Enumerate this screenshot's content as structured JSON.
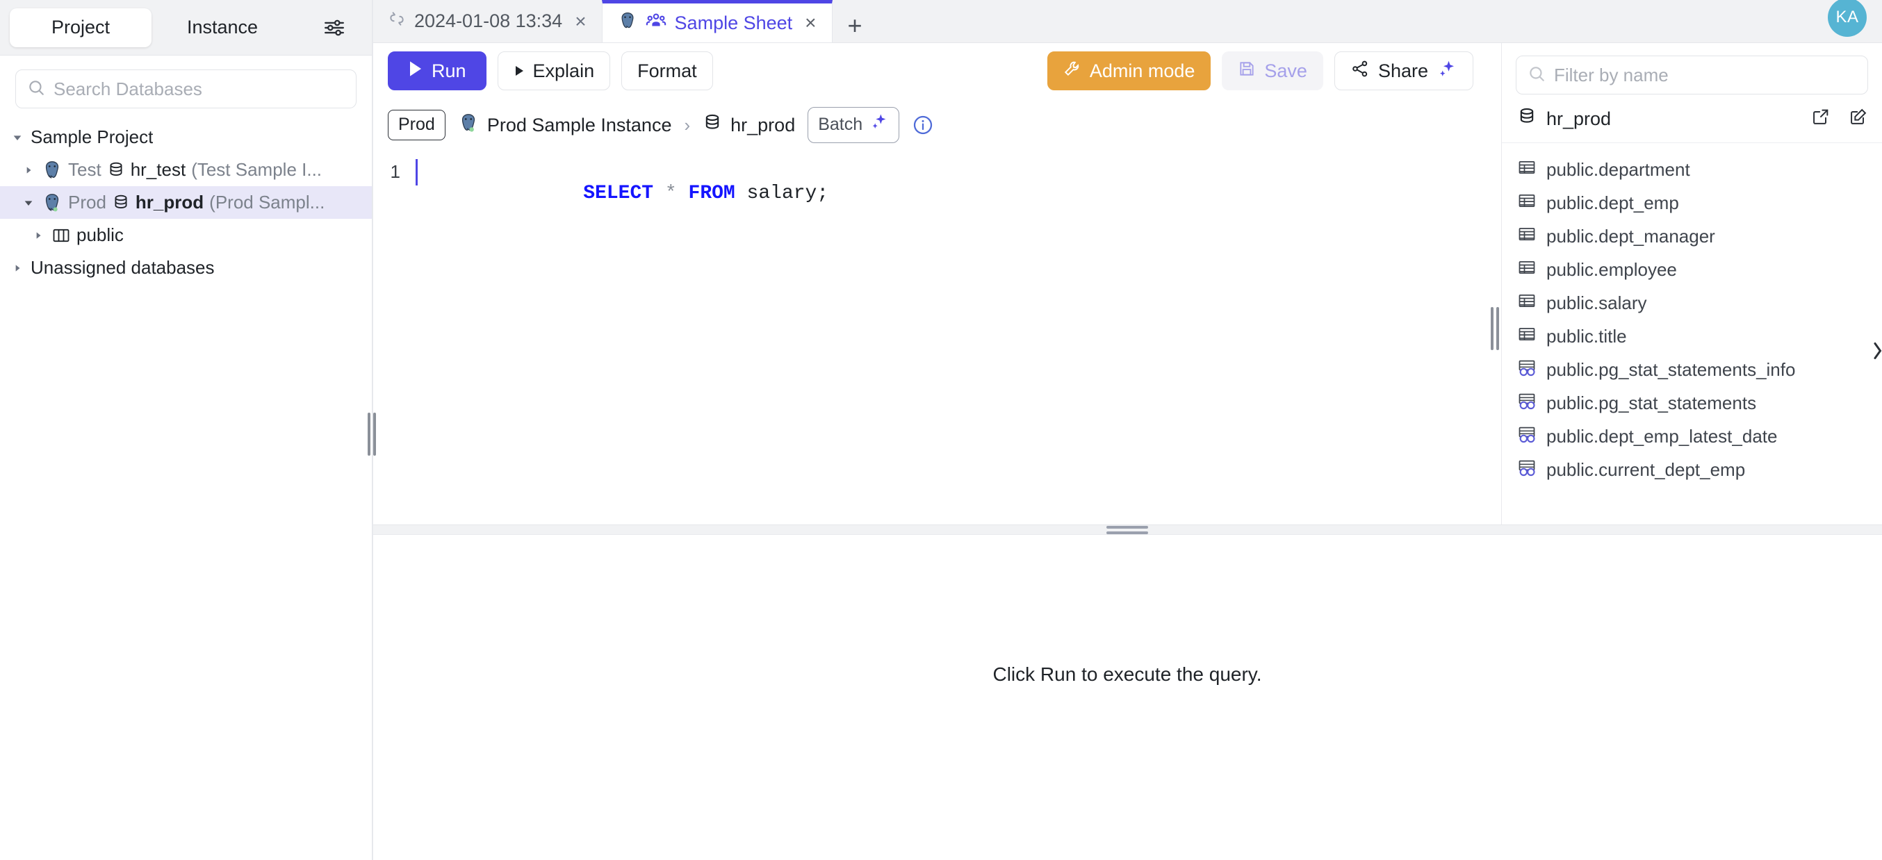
{
  "sidebar": {
    "tabs": [
      {
        "label": "Project",
        "active": true
      },
      {
        "label": "Instance",
        "active": false
      }
    ],
    "settings_icon": "sliders-icon",
    "search": {
      "placeholder": "Search Databases",
      "value": ""
    },
    "tree": [
      {
        "label": "Sample Project",
        "level": 1,
        "expanded": true,
        "type": "project"
      },
      {
        "env": "Test",
        "db": "hr_test",
        "instance": "(Test Sample I...",
        "level": 2,
        "expanded": false,
        "type": "database",
        "selected": false
      },
      {
        "env": "Prod",
        "db": "hr_prod",
        "instance": "(Prod Sampl...",
        "level": 2,
        "expanded": true,
        "type": "database",
        "selected": true
      },
      {
        "label": "public",
        "level": 3,
        "expanded": false,
        "type": "schema"
      },
      {
        "label": "Unassigned databases",
        "level": 1,
        "expanded": false,
        "type": "group"
      }
    ]
  },
  "tabbar": {
    "tabs": [
      {
        "label": "2024-01-08 13:34",
        "icon": "broken-link-icon",
        "active": false,
        "close": "×"
      },
      {
        "label": "Sample Sheet",
        "icon": "postgres-elephant-icon",
        "icon2": "people-group-icon",
        "active": true,
        "close": "×"
      }
    ],
    "new_tab": "+",
    "avatar": "KA"
  },
  "toolbar": {
    "run": "Run",
    "explain": "Explain",
    "format": "Format",
    "admin_mode": "Admin mode",
    "save": "Save",
    "share": "Share"
  },
  "context": {
    "environment": "Prod",
    "instance": "Prod Sample Instance",
    "separator": "›",
    "database": "hr_prod",
    "batch": "Batch",
    "info": "i"
  },
  "editor": {
    "line_number": "1",
    "tokens": {
      "select": "SELECT",
      "star": "*",
      "from": "FROM",
      "table": "salary;"
    },
    "full_statement": "SELECT * FROM salary;"
  },
  "schema_panel": {
    "filter": {
      "placeholder": "Filter by name",
      "value": ""
    },
    "database": "hr_prod",
    "actions": [
      "external-link-icon",
      "edit-icon"
    ],
    "items": [
      {
        "name": "public.department",
        "kind": "table"
      },
      {
        "name": "public.dept_emp",
        "kind": "table"
      },
      {
        "name": "public.dept_manager",
        "kind": "table"
      },
      {
        "name": "public.employee",
        "kind": "table"
      },
      {
        "name": "public.salary",
        "kind": "table"
      },
      {
        "name": "public.title",
        "kind": "table"
      },
      {
        "name": "public.pg_stat_statements_info",
        "kind": "view"
      },
      {
        "name": "public.pg_stat_statements",
        "kind": "view"
      },
      {
        "name": "public.dept_emp_latest_date",
        "kind": "view"
      },
      {
        "name": "public.current_dept_emp",
        "kind": "view"
      }
    ]
  },
  "results": {
    "message": "Click Run to execute the query."
  },
  "colors": {
    "accent": "#4f46e5",
    "admin": "#e8a33d",
    "avatar": "#56b4d3",
    "selected_row": "#e8e7f8",
    "keyword": "#1414ff",
    "view_icon": "#5b5bd6"
  }
}
